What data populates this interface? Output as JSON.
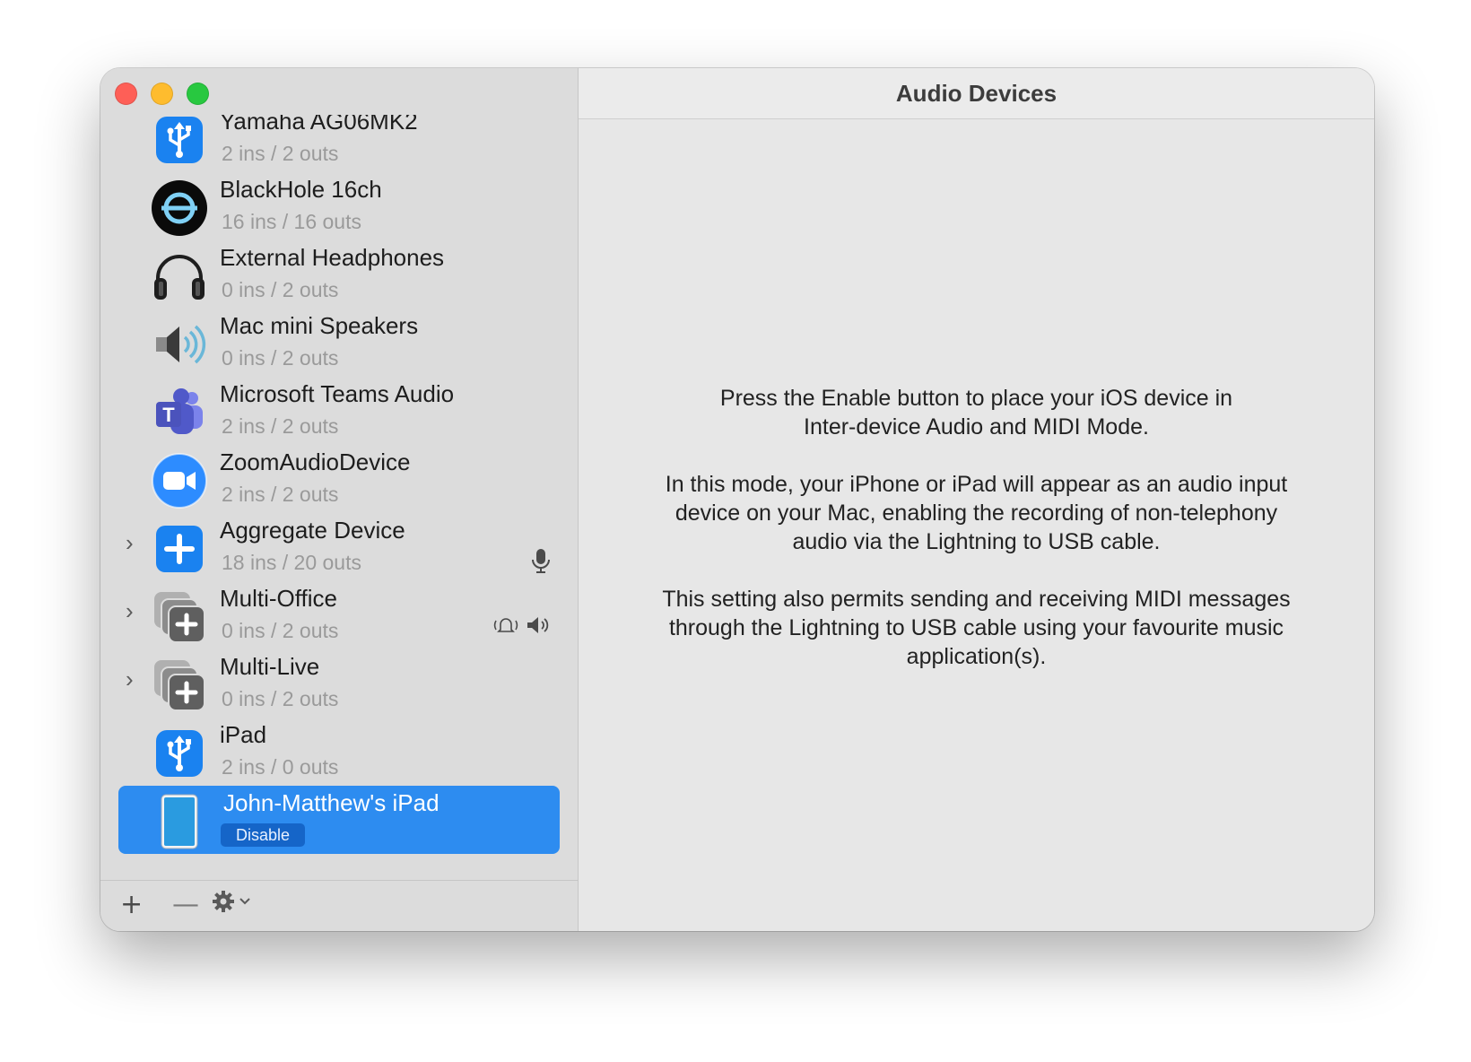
{
  "window": {
    "title": "Audio Devices"
  },
  "devices": [
    {
      "name": "Yamaha AG06MK2",
      "io": "2 ins / 2 outs",
      "icon": "usb-icon"
    },
    {
      "name": "BlackHole 16ch",
      "io": "16 ins / 16 outs",
      "icon": "blackhole-icon"
    },
    {
      "name": "External Headphones",
      "io": "0 ins / 2 outs",
      "icon": "headphones-icon"
    },
    {
      "name": "Mac mini Speakers",
      "io": "0 ins / 2 outs",
      "icon": "speaker-icon"
    },
    {
      "name": "Microsoft Teams Audio",
      "io": "2 ins / 2 outs",
      "icon": "teams-icon"
    },
    {
      "name": "ZoomAudioDevice",
      "io": "2 ins / 2 outs",
      "icon": "zoom-icon"
    },
    {
      "name": "Aggregate Device",
      "io": "18 ins / 20 outs",
      "icon": "aggregate-icon",
      "status": "microphone-icon"
    },
    {
      "name": "Multi-Office",
      "io": "0 ins / 2 outs",
      "icon": "multi-output-icon",
      "status": "alert-speaker-icon"
    },
    {
      "name": "Multi-Live",
      "io": "0 ins / 2 outs",
      "icon": "multi-output-icon"
    },
    {
      "name": "iPad",
      "io": "2 ins / 0 outs",
      "icon": "usb-icon"
    },
    {
      "name": "John-Matthew's iPad",
      "button": "Disable",
      "icon": "ipad-icon",
      "selected": true
    }
  ],
  "message": {
    "p1": "Press the Enable button to place your iOS device in\nInter-device Audio and MIDI Mode.",
    "p2": "In this mode, your iPhone or iPad will appear as an audio input\ndevice on your Mac, enabling the recording of non-telephony\naudio via the Lightning to USB cable.",
    "p3": "This setting also permits sending and receiving MIDI messages\nthrough the Lightning to USB cable using your favourite music\napplication(s)."
  },
  "toolbar": {
    "add": "+",
    "remove": "—",
    "gear": "⚙"
  },
  "colors": {
    "selection": "#2d8cf0",
    "button": "#1565c8"
  }
}
